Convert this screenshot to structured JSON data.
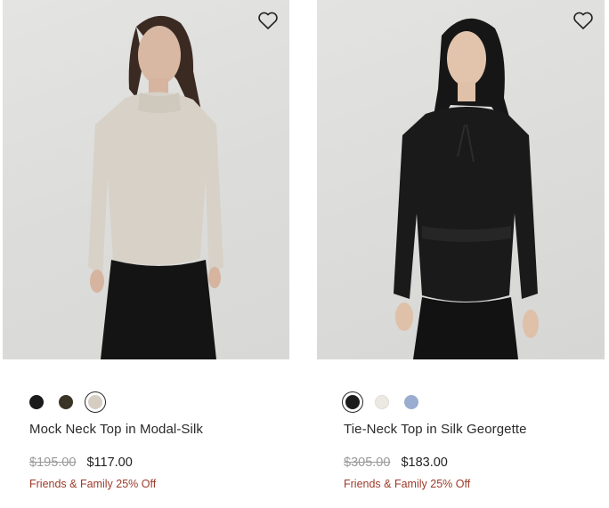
{
  "products": [
    {
      "name": "Mock Neck Top in Modal-Silk",
      "original_price": "$195.00",
      "sale_price": "$117.00",
      "promo": "Friends & Family 25% Off",
      "wishlist_icon": "heart-outline-icon",
      "swatches": [
        {
          "color": "#1b1b1b",
          "selected": false
        },
        {
          "color": "#3a3426",
          "selected": false
        },
        {
          "color": "#d6cdc2",
          "selected": true
        }
      ]
    },
    {
      "name": "Tie-Neck Top in Silk Georgette",
      "original_price": "$305.00",
      "sale_price": "$183.00",
      "promo": "Friends & Family 25% Off",
      "wishlist_icon": "heart-outline-icon",
      "swatches": [
        {
          "color": "#1b1b1b",
          "selected": true
        },
        {
          "color": "#ece8e2",
          "selected": false
        },
        {
          "color": "#9aaccf",
          "selected": false
        }
      ]
    }
  ],
  "colors": {
    "text": "#2a2a2a",
    "strike": "#9a9a9a",
    "promo": "#9c3a2a"
  }
}
